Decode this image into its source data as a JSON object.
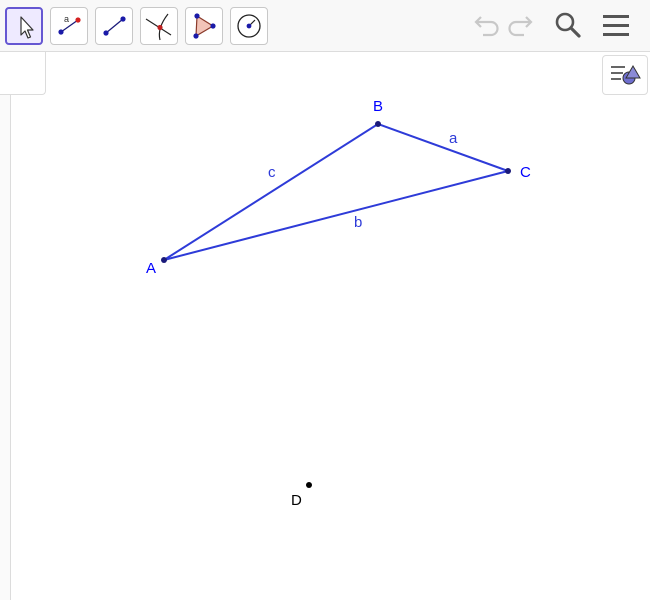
{
  "toolbar": {
    "tools": [
      {
        "name": "move",
        "icon": "cursor-arrow-icon",
        "active": true
      },
      {
        "name": "segment-with-length",
        "icon": "segment-label-icon",
        "icon_text": "a"
      },
      {
        "name": "segment",
        "icon": "segment-icon"
      },
      {
        "name": "intersect",
        "icon": "intersect-icon"
      },
      {
        "name": "polygon",
        "icon": "polygon-icon"
      },
      {
        "name": "circle",
        "icon": "circle-with-center-icon"
      }
    ],
    "actions": [
      {
        "name": "undo",
        "icon": "undo-icon",
        "enabled": false
      },
      {
        "name": "redo",
        "icon": "redo-icon",
        "enabled": false
      },
      {
        "name": "search",
        "icon": "search-icon"
      },
      {
        "name": "menu",
        "icon": "hamburger-menu-icon"
      }
    ]
  },
  "graphics": {
    "points": [
      {
        "name": "A",
        "color": "#0000ff"
      },
      {
        "name": "B",
        "color": "#0000ff"
      },
      {
        "name": "C",
        "color": "#0000ff"
      },
      {
        "name": "D",
        "color": "#000000"
      }
    ],
    "segments": [
      {
        "name": "a",
        "from": "B",
        "to": "C",
        "color": "#0000ff"
      },
      {
        "name": "b",
        "from": "A",
        "to": "C",
        "color": "#0000ff"
      },
      {
        "name": "c",
        "from": "A",
        "to": "B",
        "color": "#0000ff"
      }
    ]
  },
  "colors": {
    "accent": "#6557d2",
    "object_blue": "#2e3bd8",
    "point_blue": "#0000ff",
    "toolbar_bg": "#f8f8f8"
  }
}
